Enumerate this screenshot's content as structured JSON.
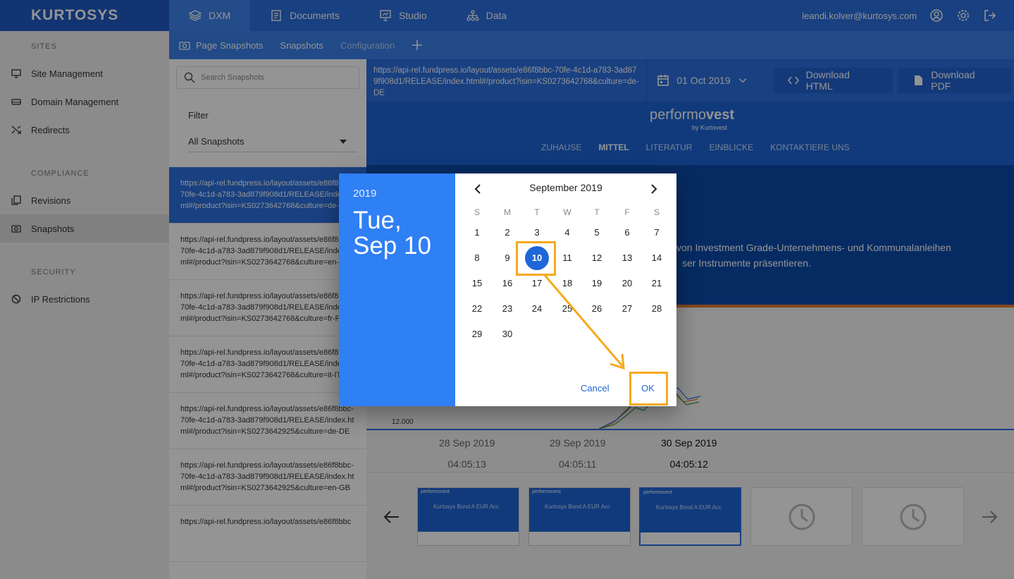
{
  "brand": {
    "logo": "KURTOSYS"
  },
  "topnav": [
    {
      "label": "DXM",
      "icon": "layers-icon"
    },
    {
      "label": "Documents",
      "icon": "document-icon"
    },
    {
      "label": "Studio",
      "icon": "presentation-icon"
    },
    {
      "label": "Data",
      "icon": "hierarchy-icon"
    }
  ],
  "user": {
    "email": "leandi.kolver@kurtosys.com"
  },
  "sidebar": {
    "sections": [
      {
        "title": "SITES",
        "items": [
          "Site Management",
          "Domain Management",
          "Redirects"
        ]
      },
      {
        "title": "COMPLIANCE",
        "items": [
          "Revisions",
          "Snapshots"
        ]
      },
      {
        "title": "SECURITY",
        "items": [
          "IP Restrictions"
        ]
      }
    ]
  },
  "subnav": {
    "page_snapshots": "Page Snapshots",
    "snapshots": "Snapshots",
    "configuration": "Configuration"
  },
  "search": {
    "placeholder": "Search Snapshots"
  },
  "filter": {
    "label": "Filter",
    "value": "All Snapshots"
  },
  "snapshots": [
    "https://api-rel.fundpress.io/layout/assets/e86f8bbc-70fe-4c1d-a783-3ad879f908d1/RELEASE/index.html#/product?isin=KS0273642768&culture=de-DE",
    "https://api-rel.fundpress.io/layout/assets/e86f8bbc-70fe-4c1d-a783-3ad879f908d1/RELEASE/index.html#/product?isin=KS0273642768&culture=en-GB",
    "https://api-rel.fundpress.io/layout/assets/e86f8bbc-70fe-4c1d-a783-3ad879f908d1/RELEASE/index.html#/product?isin=KS0273642768&culture=fr-FR",
    "https://api-rel.fundpress.io/layout/assets/e86f8bbc-70fe-4c1d-a783-3ad879f908d1/RELEASE/index.html#/product?isin=KS0273642768&culture=it-IT",
    "https://api-rel.fundpress.io/layout/assets/e86f8bbc-70fe-4c1d-a783-3ad879f908d1/RELEASE/index.html#/product?isin=KS0273642925&culture=de-DE",
    "https://api-rel.fundpress.io/layout/assets/e86f8bbc-70fe-4c1d-a783-3ad879f908d1/RELEASE/index.html#/product?isin=KS0273642925&culture=en-GB",
    "https://api-rel.fundpress.io/layout/assets/e86f8bbc"
  ],
  "toolbar": {
    "url": "https://api-rel.fundpress.io/layout/assets/e86f8bbc-70fe-4c1d-a783-3ad879f908d1/RELEASE/index.html#/product?isin=KS0273642768&culture=de-DE",
    "date": "01 Oct 2019",
    "download_html": "Download HTML",
    "download_pdf": "Download PDF"
  },
  "preview": {
    "logo_a": "performo",
    "logo_b": "vest",
    "by": "by Kurtovest",
    "nav": [
      "ZUHAUSE",
      "MITTEL",
      "LITERATUR",
      "EINBLICKE",
      "KONTAKTIERE UNS"
    ],
    "text_line1": "von Investment Grade-Unternehmens- und Kommunalanleihen",
    "text_line2": "ser Instrumente präsentieren.",
    "chart_tick": "12.000"
  },
  "timeline": [
    {
      "date": "28 Sep 2019",
      "time": "04:05:13"
    },
    {
      "date": "29 Sep 2019",
      "time": "04:05:11"
    },
    {
      "date": "30 Sep 2019",
      "time": "04:05:12"
    }
  ],
  "thumbs": {
    "logo": "performovest",
    "title": "Kurtosys Bond A EUR Acc"
  },
  "dialog": {
    "year": "2019",
    "date_line1": "Tue,",
    "date_line2": "Sep 10",
    "month": "September 2019",
    "weekdays": [
      "S",
      "M",
      "T",
      "W",
      "T",
      "F",
      "S"
    ],
    "days": [
      1,
      2,
      3,
      4,
      5,
      6,
      7,
      8,
      9,
      10,
      11,
      12,
      13,
      14,
      15,
      16,
      17,
      18,
      19,
      20,
      21,
      22,
      23,
      24,
      25,
      26,
      27,
      28,
      29,
      30
    ],
    "first_weekday": 0,
    "selected_day": 10,
    "cancel": "Cancel",
    "ok": "OK"
  },
  "colors": {
    "primary": "#2b6fdc",
    "accent_highlight": "#f6a91e",
    "dialog_header": "#2f7ff5"
  }
}
